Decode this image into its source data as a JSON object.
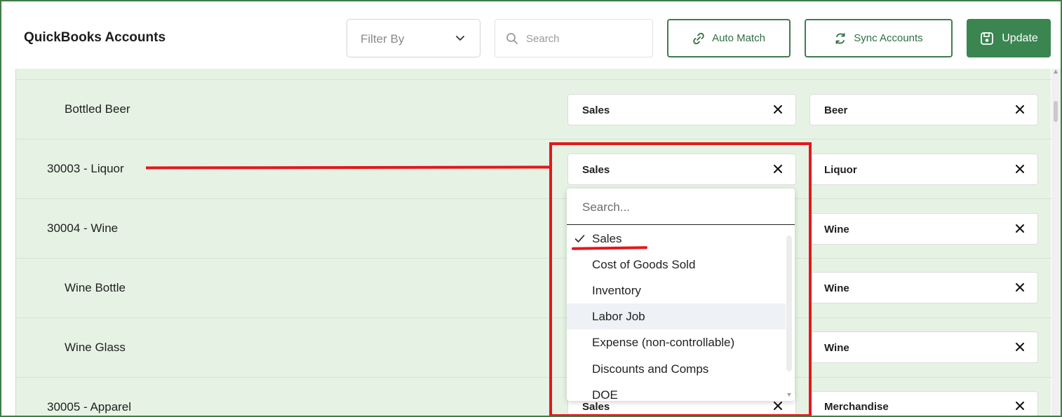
{
  "header": {
    "title": "QuickBooks Accounts",
    "filter_label": "Filter By",
    "search_placeholder": "Search",
    "auto_match_label": "Auto Match",
    "sync_label": "Sync Accounts",
    "update_label": "Update"
  },
  "rows": [
    {
      "name": "Bottled Beer",
      "col1": "Sales",
      "col2": "Beer"
    },
    {
      "name": "30003 - Liquor",
      "col1": "Sales",
      "col2": "Liquor"
    },
    {
      "name": "30004 - Wine",
      "col1": "",
      "col2": "Wine"
    },
    {
      "name": "Wine Bottle",
      "col1": "",
      "col2": "Wine"
    },
    {
      "name": "Wine Glass",
      "col1": "",
      "col2": "Wine"
    },
    {
      "name": "30005 - Apparel",
      "col1": "Sales",
      "col2": "Merchandise"
    }
  ],
  "dropdown": {
    "search_placeholder": "Search...",
    "selected": "Sales",
    "hovered": "Labor Job",
    "options": [
      "Sales",
      "Cost of Goods Sold",
      "Inventory",
      "Labor Job",
      "Expense (non-controllable)",
      "Discounts and Comps",
      "DOE"
    ]
  },
  "colors": {
    "brand_green": "#3a8550",
    "row_bg": "#e6f3e4",
    "annotation_red": "#e4171b"
  }
}
